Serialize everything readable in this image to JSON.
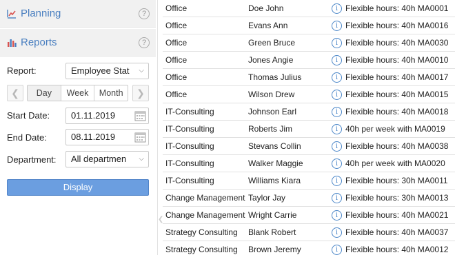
{
  "sidebar": {
    "planning": {
      "label": "Planning",
      "help": "?"
    },
    "reports": {
      "label": "Reports",
      "help": "?"
    }
  },
  "form": {
    "report_label": "Report:",
    "report_value": "Employee Stat",
    "day": "Day",
    "week": "Week",
    "month": "Month",
    "prev": "❮",
    "next": "❯",
    "start_label": "Start Date:",
    "start_value": "01.11.2019",
    "end_label": "End Date:",
    "end_value": "08.11.2019",
    "dept_label": "Department:",
    "dept_value": "All departmen",
    "display_label": "Display"
  },
  "rows": [
    {
      "dept": "Office",
      "name": "Doe John",
      "desc": "Flexible hours: 40h MA0001"
    },
    {
      "dept": "Office",
      "name": "Evans Ann",
      "desc": "Flexible hours: 40h MA0016"
    },
    {
      "dept": "Office",
      "name": "Green Bruce",
      "desc": "Flexible hours: 40h MA0030"
    },
    {
      "dept": "Office",
      "name": "Jones Angie",
      "desc": "Flexible hours: 40h MA0010"
    },
    {
      "dept": "Office",
      "name": "Thomas Julius",
      "desc": "Flexible hours: 40h MA0017"
    },
    {
      "dept": "Office",
      "name": "Wilson Drew",
      "desc": "Flexible hours: 40h MA0015"
    },
    {
      "dept": "IT-Consulting",
      "name": "Johnson Earl",
      "desc": "Flexible hours: 40h MA0018"
    },
    {
      "dept": "IT-Consulting",
      "name": "Roberts Jim",
      "desc": "40h per week with  MA0019"
    },
    {
      "dept": "IT-Consulting",
      "name": "Stevans Collin",
      "desc": "Flexible hours: 40h MA0038"
    },
    {
      "dept": "IT-Consulting",
      "name": "Walker Maggie",
      "desc": "40h per week with  MA0020"
    },
    {
      "dept": "IT-Consulting",
      "name": "Williams Kiara",
      "desc": "Flexible hours: 30h MA0011"
    },
    {
      "dept": "Change Management",
      "name": "Taylor Jay",
      "desc": "Flexible hours: 30h MA0013"
    },
    {
      "dept": "Change Management",
      "name": "Wright Carrie",
      "desc": "Flexible hours: 40h MA0021"
    },
    {
      "dept": "Strategy Consulting",
      "name": "Blank Robert",
      "desc": "Flexible hours: 40h MA0037"
    },
    {
      "dept": "Strategy Consulting",
      "name": "Brown Jeremy",
      "desc": "Flexible hours: 40h MA0012"
    }
  ],
  "info_glyph": "i",
  "colors": {
    "accent": "#4a7fc0",
    "button": "#6b9ee0"
  }
}
